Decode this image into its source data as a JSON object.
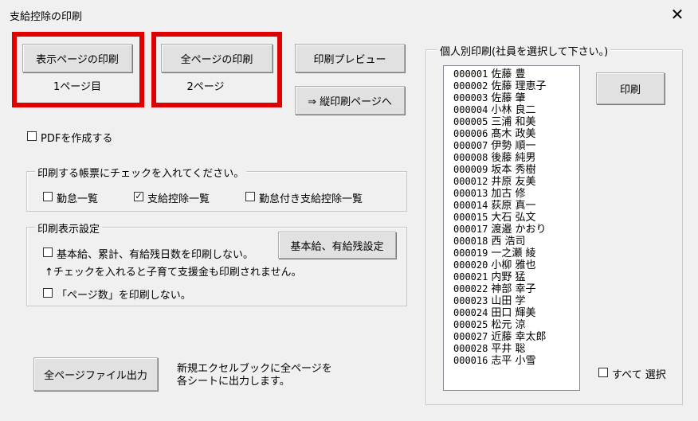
{
  "window": {
    "title": "支給控除の印刷",
    "close_glyph": "✕"
  },
  "print_buttons": {
    "display_page": {
      "label": "表示ページの印刷",
      "sub": "1ページ目"
    },
    "all_pages": {
      "label": "全ページの印刷",
      "sub": "2ページ"
    },
    "preview": "印刷プレビュー",
    "portrait": "⇒ 縦印刷ページへ"
  },
  "pdf": {
    "label": "PDFを作成する",
    "checked": false
  },
  "ledger_group": {
    "title": "印刷する帳票にチェックを入れてください。",
    "items": [
      {
        "label": "勤怠一覧",
        "checked": false
      },
      {
        "label": "支給控除一覧",
        "checked": true
      },
      {
        "label": "勤怠付き支給控除一覧",
        "checked": false
      }
    ]
  },
  "display_group": {
    "title": "印刷表示設定",
    "no_salary": {
      "label": "基本給、累計、有給残日数を印刷しない。",
      "checked": false
    },
    "note": "↑チェックを入れると子育て支援金も印刷されません。",
    "no_page_num": {
      "label": "「ページ数」を印刷しない。",
      "checked": false
    },
    "settings_button": "基本給、有給残設定"
  },
  "export": {
    "button": "全ページファイル出力",
    "desc_line1": "新規エクセルブックに全ページを",
    "desc_line2": "各シートに出力します。"
  },
  "employee_group": {
    "title": "個人別印刷(社員を選択して下さい。)",
    "print_button": "印刷",
    "select_all": {
      "label": "すべて 選択",
      "checked": false
    },
    "employees": [
      {
        "code": "000001",
        "name": "佐藤 豊"
      },
      {
        "code": "000002",
        "name": "佐藤 理恵子"
      },
      {
        "code": "000003",
        "name": "佐藤 肇"
      },
      {
        "code": "000004",
        "name": "小林 良二"
      },
      {
        "code": "000005",
        "name": "三浦  和美"
      },
      {
        "code": "000006",
        "name": "髙木 政美"
      },
      {
        "code": "000007",
        "name": "伊勢  順一"
      },
      {
        "code": "000008",
        "name": "後藤 純男"
      },
      {
        "code": "000009",
        "name": "坂本 秀樹"
      },
      {
        "code": "000012",
        "name": "井原 友美"
      },
      {
        "code": "000013",
        "name": "加古 修"
      },
      {
        "code": "000014",
        "name": "荻原 真一"
      },
      {
        "code": "000015",
        "name": "大石 弘文"
      },
      {
        "code": "000017",
        "name": "渡邉 かおり"
      },
      {
        "code": "000018",
        "name": "西 浩司"
      },
      {
        "code": "000019",
        "name": "一之瀬 綾"
      },
      {
        "code": "000020",
        "name": "小柳 雅也"
      },
      {
        "code": "000021",
        "name": "内野 猛"
      },
      {
        "code": "000022",
        "name": "神部 幸子"
      },
      {
        "code": "000023",
        "name": "山田 学"
      },
      {
        "code": "000024",
        "name": "田口 輝美"
      },
      {
        "code": "000025",
        "name": "松元 涼"
      },
      {
        "code": "000027",
        "name": "近藤 幸太郎"
      },
      {
        "code": "000028",
        "name": "平井 聡"
      },
      {
        "code": "000016",
        "name": "志平 小雪"
      }
    ]
  },
  "colors": {
    "highlight": "#e00000",
    "background": "#f0f0f0"
  }
}
